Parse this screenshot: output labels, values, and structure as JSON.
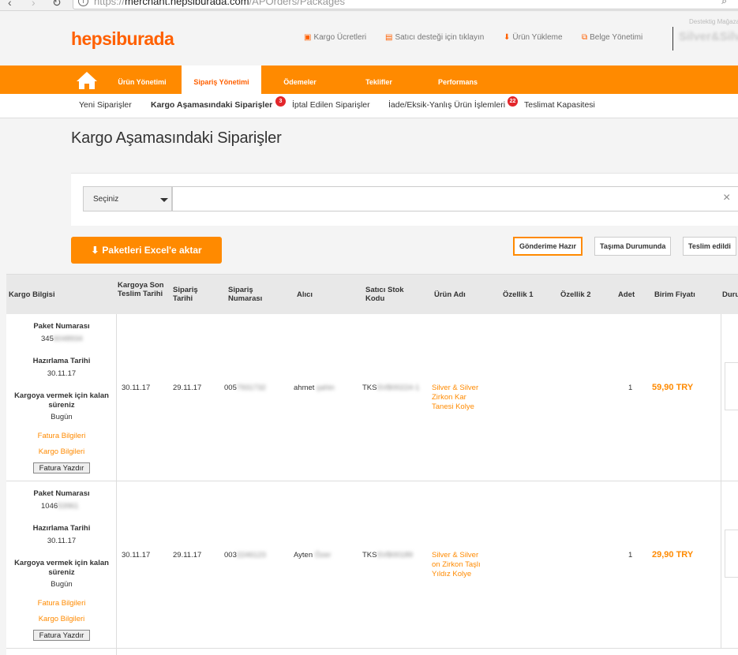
{
  "browser": {
    "url_prefix": "https://",
    "url_host": "merchant.hepsiburada.com",
    "url_path": "/APOrders/Packages"
  },
  "header": {
    "logo": "hepsiburada",
    "links": [
      {
        "icon": "cube-icon",
        "label": "Kargo Ücretleri"
      },
      {
        "icon": "document-icon",
        "label": "Satıcı desteği için tıklayın"
      },
      {
        "icon": "download-icon",
        "label": "Ürün Yükleme"
      },
      {
        "icon": "copy-icon",
        "label": "Belge Yönetimi"
      }
    ],
    "store_label": "Destektig Mağaza:",
    "store_name": "Silver&Silver"
  },
  "nav": {
    "tabs": [
      "Ürün Yönetimi",
      "Sipariş Yönetimi",
      "Ödemeler",
      "Teklifler",
      "Performans"
    ]
  },
  "subnav": {
    "items": [
      "Yeni Siparişler",
      "Kargo Aşamasındaki Siparişler",
      "İptal Edilen Siparişler",
      "İade/Eksik-Yanlış Ürün İşlemleri",
      "Teslimat Kapasitesi"
    ],
    "badge_kargo": "3",
    "badge_iade": "22"
  },
  "page_title": "Kargo Aşamasındaki Siparişler",
  "filter": {
    "select_value": "Seçiniz",
    "search_value": ""
  },
  "actions": {
    "excel_label": "Paketleri Excel'e aktar",
    "status_buttons": [
      "Gönderime Hazır",
      "Taşıma Durumunda",
      "Teslim edildi"
    ]
  },
  "table": {
    "headers": {
      "kargo_bilgisi": "Kargo Bilgisi",
      "son_teslim": "Kargoya Son Teslim Tarihi",
      "siparis_tarihi": "Sipariş Tarihi",
      "siparis_no": "Sipariş Numarası",
      "alici": "Alıcı",
      "stok_kodu": "Satıcı Stok Kodu",
      "urun_adi": "Ürün Adı",
      "ozellik1": "Özellik 1",
      "ozellik2": "Özellik 2",
      "adet": "Adet",
      "birim_fiyati": "Birim Fiyatı",
      "durum": "Durum"
    },
    "labels": {
      "paket_no": "Paket Numarası",
      "hazirlama": "Hazırlama Tarihi",
      "kalan_sure": "Kargoya vermek için kalan süreniz",
      "fatura": "Fatura Bilgileri",
      "kargo": "Kargo Bilgileri",
      "yazdir": "Fatura Yazdır"
    },
    "rows": [
      {
        "paket_no_visible": "345",
        "paket_no_hidden": "6048934",
        "hazirlama": "30.11.17",
        "kalan": "Bugün",
        "son_teslim": "30.11.17",
        "siparis_tarihi": "29.11.17",
        "siparis_no_visible": "005",
        "siparis_no_hidden": "7931732",
        "alici_visible": "ahmet",
        "alici_hidden": "şahin",
        "stok_visible": "TKS",
        "stok_hidden": "SVB00224-1",
        "urun": [
          "Silver & Silver",
          "Zirkon Kar",
          "Tanesi Kolye"
        ],
        "adet": "1",
        "fiyat": "59,90 TRY"
      },
      {
        "paket_no_visible": "1046",
        "paket_no_hidden": "53961",
        "hazirlama": "30.11.17",
        "kalan": "Bugün",
        "son_teslim": "30.11.17",
        "siparis_tarihi": "29.11.17",
        "siparis_no_visible": "003",
        "siparis_no_hidden": "2246123",
        "alici_visible": "Ayten",
        "alici_hidden": "Özer",
        "stok_visible": "TKS",
        "stok_hidden": "SVB00189",
        "urun": [
          "Silver & Silver",
          "on Zirkon Taşlı",
          "Yıldız Kolye"
        ],
        "adet": "1",
        "fiyat": "29,90 TRY"
      }
    ]
  }
}
